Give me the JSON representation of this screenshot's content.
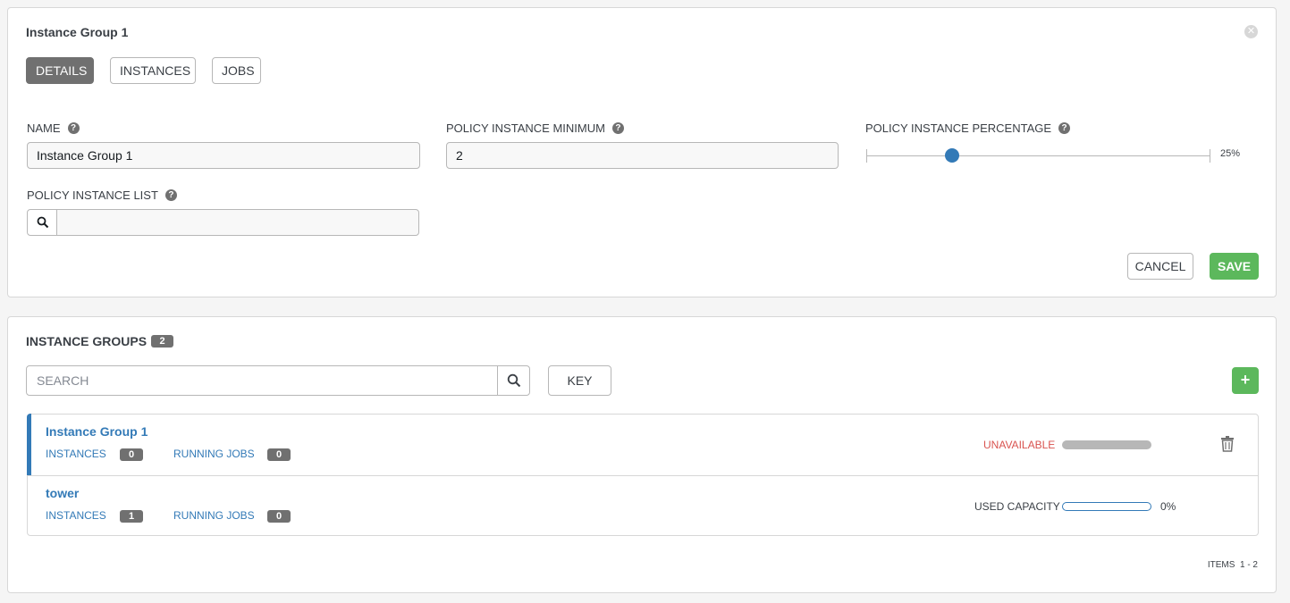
{
  "detail": {
    "title": "Instance Group 1",
    "tabs": [
      {
        "label": "DETAILS",
        "active": true
      },
      {
        "label": "INSTANCES",
        "active": false
      },
      {
        "label": "JOBS",
        "active": false
      }
    ],
    "fields": {
      "name": {
        "label": "NAME",
        "value": "Instance Group 1"
      },
      "policy_min": {
        "label": "POLICY INSTANCE MINIMUM",
        "value": "2"
      },
      "policy_pct": {
        "label": "POLICY INSTANCE PERCENTAGE",
        "value_label": "25%",
        "value": 25
      },
      "policy_list": {
        "label": "POLICY INSTANCE LIST",
        "value": ""
      }
    },
    "buttons": {
      "cancel": "CANCEL",
      "save": "SAVE"
    }
  },
  "list": {
    "title": "INSTANCE GROUPS",
    "count": "2",
    "search_placeholder": "SEARCH",
    "key_label": "KEY",
    "add_label": "+",
    "items": [
      {
        "name": "Instance Group 1",
        "instances_label": "INSTANCES",
        "instances": "0",
        "running_jobs_label": "RUNNING JOBS",
        "running_jobs": "0",
        "capacity_label": "UNAVAILABLE",
        "capacity_pct": "",
        "selected": true
      },
      {
        "name": "tower",
        "instances_label": "INSTANCES",
        "instances": "1",
        "running_jobs_label": "RUNNING JOBS",
        "running_jobs": "0",
        "capacity_label": "USED CAPACITY",
        "capacity_pct": "0%",
        "capacity_value": 0,
        "selected": false
      }
    ],
    "pagination": {
      "label": "ITEMS",
      "range": "1 - 2"
    }
  },
  "colors": {
    "accent": "#337ab7",
    "success": "#5cb85c",
    "danger": "#d9534f",
    "muted": "#707070"
  }
}
